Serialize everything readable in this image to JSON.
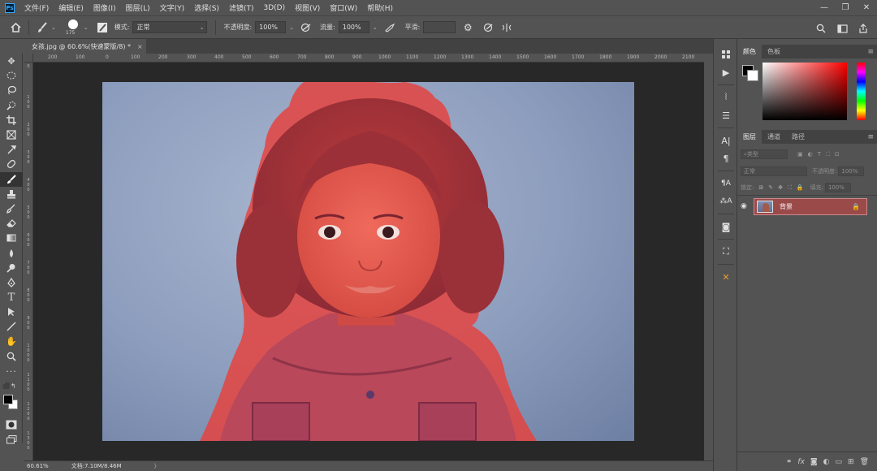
{
  "app": {
    "logo": "Ps"
  },
  "menu": [
    "文件(F)",
    "编辑(E)",
    "图像(I)",
    "图层(L)",
    "文字(Y)",
    "选择(S)",
    "滤镜(T)",
    "3D(D)",
    "视图(V)",
    "窗口(W)",
    "帮助(H)"
  ],
  "window_controls": {
    "minimize": "—",
    "restore": "❐",
    "close": "✕"
  },
  "options_bar": {
    "brush_size": "175",
    "mode_label": "模式:",
    "mode_value": "正常",
    "opacity_label": "不透明度:",
    "opacity_value": "100%",
    "flow_label": "流量:",
    "flow_value": "100%",
    "smooth_label": "平滑:"
  },
  "document_tab": {
    "title": "女孩.jpg @ 60.6%(快速蒙版/8) *",
    "close": "×"
  },
  "ruler_h": [
    "200",
    "100",
    "0",
    "100",
    "200",
    "300",
    "400",
    "500",
    "600",
    "700",
    "800",
    "900",
    "1000",
    "1100",
    "1200",
    "1300",
    "1400",
    "1500",
    "1600",
    "1700",
    "1800",
    "1900",
    "2000",
    "2100"
  ],
  "ruler_v": [
    "0",
    "1\n0\n0",
    "2\n0\n0",
    "3\n0\n0",
    "4\n0\n0",
    "5\n0\n0",
    "6\n0\n0",
    "7\n0\n0",
    "8\n0\n0",
    "9\n0\n0",
    "1\n0\n0\n0",
    "1\n1\n0\n0",
    "1\n2\n0\n0",
    "1\n3\n0\n0",
    "1\n4\n0\n0"
  ],
  "status": {
    "zoom": "60.61%",
    "doc_info": "文档:7.10M/8.46M",
    "arrow": "〉"
  },
  "color_panel": {
    "tabs": [
      "颜色",
      "色板"
    ],
    "fg_color": "#000000",
    "bg_color": "#ffffff"
  },
  "layers_panel": {
    "tabs": [
      "图层",
      "通道",
      "路径"
    ],
    "filter_placeholder": "类型",
    "blend_mode": "正常",
    "opacity_label": "不透明度:",
    "opacity_value": "100%",
    "lock_label": "锁定:",
    "fill_label": "填充:",
    "fill_value": "100%",
    "layers": [
      {
        "name": "背景",
        "locked": true,
        "visible": true
      }
    ]
  },
  "colors": {
    "quick_mask": "#e8403a",
    "selected_layer": "#9b4a4a"
  }
}
